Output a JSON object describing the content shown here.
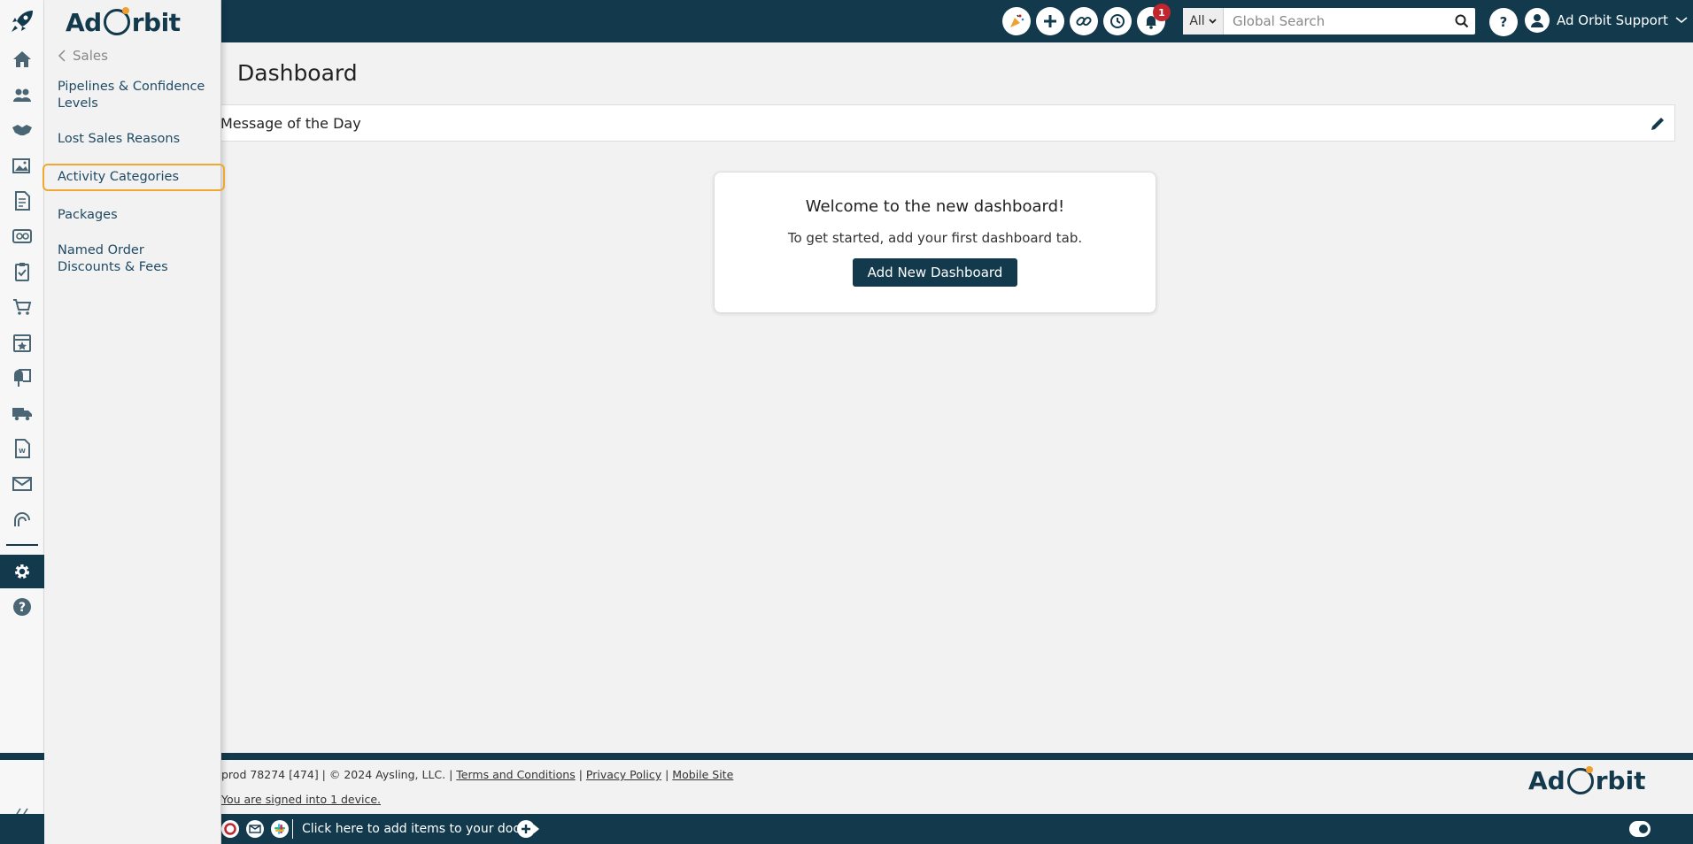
{
  "header": {
    "search_scope": "All",
    "search_placeholder": "Global Search",
    "notification_count": "1",
    "user_name": "Ad Orbit Support"
  },
  "brand": {
    "logo_left": "Ad",
    "logo_right": "rbit"
  },
  "flyout": {
    "back_label": "Sales",
    "items": [
      {
        "label": "Pipelines & Confidence Levels"
      },
      {
        "label": "Lost Sales Reasons"
      },
      {
        "label": "Activity Categories"
      },
      {
        "label": "Packages"
      },
      {
        "label": "Named Order Discounts & Fees"
      }
    ]
  },
  "main": {
    "title": "Dashboard",
    "motd_title": "Message of the Day",
    "welcome_title": "Welcome to the new dashboard!",
    "welcome_text": "To get started, add your first dashboard tab.",
    "add_button": "Add New Dashboard"
  },
  "footer": {
    "build": "prod 78274 [474] | © 2024 Aysling, LLC. |",
    "terms": "Terms and Conditions",
    "sep1": "|",
    "privacy": "Privacy Policy",
    "sep2": "|",
    "mobile": "Mobile Site",
    "signed_in": "You are signed into 1 device."
  },
  "dock": {
    "text": "Click here to add items to your dock"
  },
  "colors": {
    "primary": "#12394c",
    "accent": "#f0a830",
    "badge": "#c0262d"
  }
}
